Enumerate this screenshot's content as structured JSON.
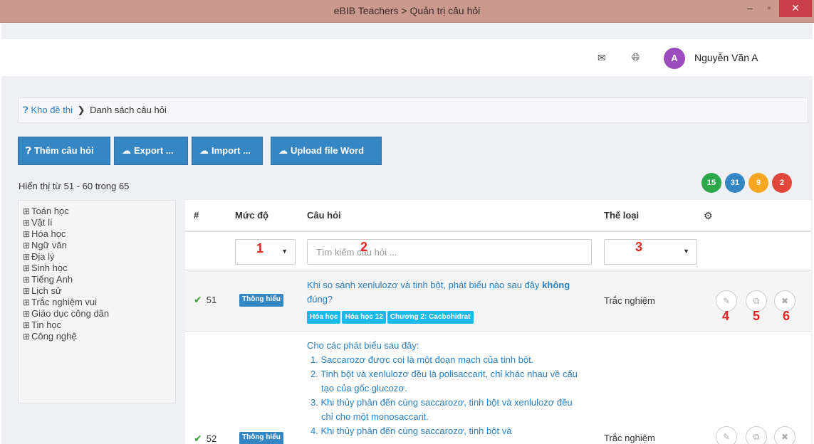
{
  "window": {
    "title": "eBIB Teachers > Quản trị câu hỏi",
    "controls": {
      "minimize": "–",
      "maximize": "▫",
      "close": "✕"
    }
  },
  "topnav": {
    "user_initial": "A",
    "user_name": "Nguyễn Văn A",
    "icons": [
      "mail-icon",
      "globe-icon"
    ]
  },
  "breadcrumb": {
    "root": "Kho đề thi",
    "separator": "❯",
    "current": "Danh sách câu hỏi"
  },
  "toolbar": {
    "add_label": "Thêm câu hỏi",
    "export_label": "Export ...",
    "import_label": "Import ...",
    "upload_label": "Upload file Word"
  },
  "summary": {
    "showing": "Hiển thị từ 51 - 60 trong 65",
    "badges": [
      {
        "value": "15",
        "color": "#2aa84a"
      },
      {
        "value": "31",
        "color": "#3587c4"
      },
      {
        "value": "9",
        "color": "#f5a623"
      },
      {
        "value": "2",
        "color": "#e0463a"
      }
    ]
  },
  "sidebar": {
    "toggle_symbol": "⊞",
    "items": [
      "Toán học",
      "Vật lí",
      "Hóa học",
      "Ngữ văn",
      "Địa lý",
      "Sinh học",
      "Tiếng Anh",
      "Lịch sử",
      "Trắc nghiệm vui",
      "Giáo dục công dân",
      "Tin học",
      "Công nghệ"
    ]
  },
  "table": {
    "headers": {
      "num": "#",
      "level": "Mức độ",
      "question": "Câu hỏi",
      "type": "Thể loại",
      "settings_icon": "gears-icon"
    },
    "filters": {
      "search_placeholder": "Tìm kiếm câu hỏi ..."
    },
    "rows": [
      {
        "num": "51",
        "level": "Thông hiểu",
        "question_before": "Khi so sánh xenlulozơ và tinh bột, phát biểu nào sau đây",
        "question_bold": "không",
        "question_after": "đúng?",
        "tags": [
          "Hóa học",
          "Hóa học 12",
          "Chương 2: Cacbohiđrat"
        ],
        "type": "Trắc nghiệm"
      },
      {
        "num": "52",
        "level": "Thông hiểu",
        "question_lead": "Cho các phát biểu sau đây:",
        "items": [
          "1. Saccarozơ được coi là một đoạn mạch của tinh bột.",
          "2. Tinh bột và xenlulozơ đều là polisaccarit, chỉ khác nhau về cấu tạo của gốc glucozơ.",
          "3. Khi thủy phân đến cùng saccarozơ, tinh bột và xenlulozơ đều chỉ cho một monosaccarit.",
          "4. Khi thủy phân đến cùng saccarozơ, tinh bột và"
        ],
        "type": "Trắc nghiệm"
      }
    ],
    "actions": [
      "edit-icon",
      "copy-icon",
      "delete-icon"
    ]
  },
  "annotations": [
    "1",
    "2",
    "3",
    "4",
    "5",
    "6"
  ]
}
